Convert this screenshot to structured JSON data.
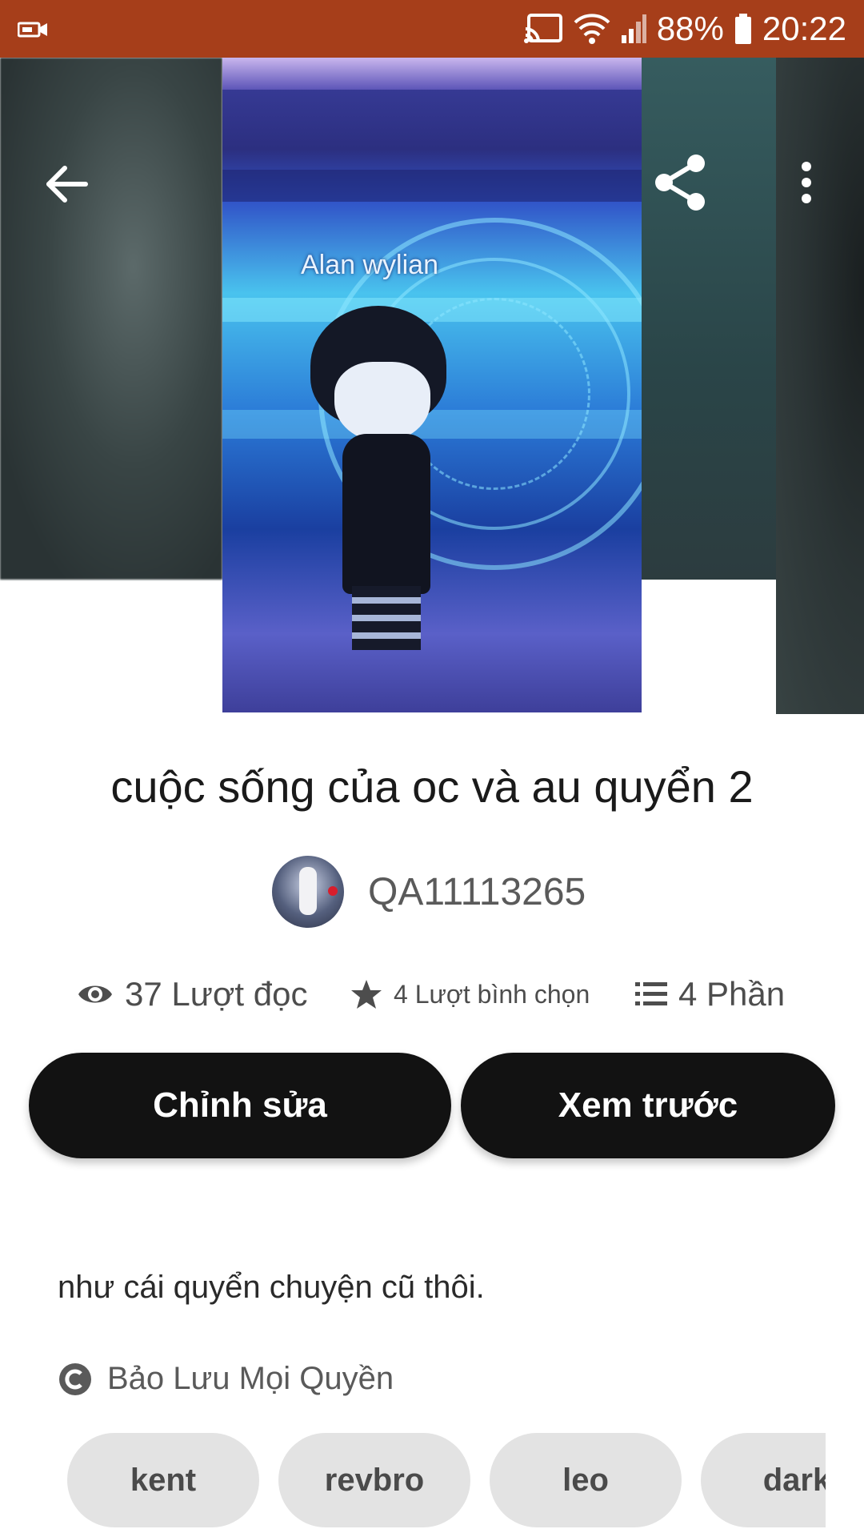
{
  "status_bar": {
    "battery": "88%",
    "time": "20:22",
    "icons": [
      "camera-recording-icon",
      "cast-icon",
      "wifi-icon",
      "signal-icon",
      "battery-icon"
    ]
  },
  "toolbar": {
    "icons": [
      "back-arrow-icon",
      "share-icon",
      "more-vert-icon"
    ]
  },
  "cover": {
    "text": "Alan wylian"
  },
  "story": {
    "title": "cuộc sống của oc và au quyển 2",
    "author": "QA11113265"
  },
  "stats": {
    "reads": "37 Lượt đọc",
    "votes": "4 Lượt bình chọn",
    "parts": "4 Phần"
  },
  "actions": {
    "edit": "Chỉnh sửa",
    "preview": "Xem trước"
  },
  "description": "như cái quyển chuyện cũ thôi.",
  "copyright": "Bảo Lưu Mọi Quyền",
  "tags": [
    "kent",
    "revbro",
    "leo",
    "dark"
  ],
  "colors": {
    "status_bar": "#a63e1a",
    "button_bg": "#121212",
    "tag_bg": "#e3e3e3"
  }
}
